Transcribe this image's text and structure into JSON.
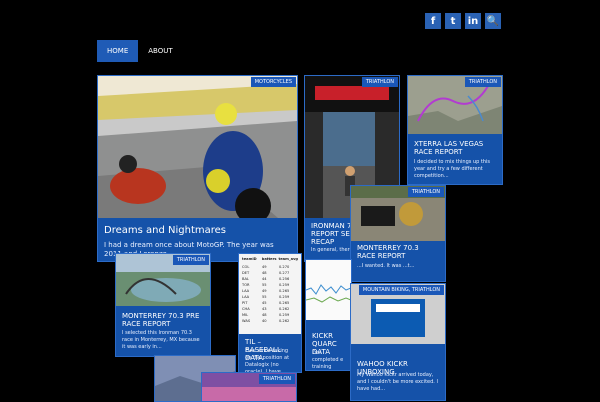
{
  "social": [
    "f",
    "t",
    "in",
    "🔍"
  ],
  "nav": [
    "HOME",
    "ABOUT"
  ],
  "cards": {
    "motogp": {
      "category": "MOTORCYCLES",
      "title": "Dreams and Nightmares",
      "excerpt": "I had a dream once about MotoGP. The year was 2011 and Lorenzo..."
    },
    "ironman": {
      "category": "TRIATHLON",
      "title": "IRONMAN 70.3 RACE REPORT SEASON RECAP",
      "excerpt": "In general, there you a..."
    },
    "xterra": {
      "category": "TRIATHLON",
      "title": "XTERRA LAS VEGAS RACE REPORT",
      "excerpt": "I decided to mix things up this year and try a few different competition..."
    },
    "monterrey": {
      "category": "TRIATHLON",
      "title": "MONTERREY 70.3 RACE REPORT",
      "excerpt": "...I wanted. It was ...t..."
    },
    "pre": {
      "category": "TRIATHLON",
      "title": "MONTERREY 70.3 PRE RACE REPORT",
      "excerpt": "I selected this Ironman 70.3 race in Monterrey, MX because it was early in..."
    },
    "baseball": {
      "title": "TIL – BASEBALL DATA",
      "excerpt": "Ever since taking on the position at Datalogix (no oracle), I have been..."
    },
    "kickr": {
      "title": "KICKR QUARC DATA",
      "excerpt": "I've completed e training session ... Kickr. During my..."
    },
    "wahoo": {
      "category": "MOUNTAIN BIKING, TRIATHLON",
      "title": "WAHOO KICKR UNBOXING",
      "excerpt": "My Wahoo Kickr arrived today, and I couldn't be more excited. I have had..."
    },
    "bottom": {
      "category": "TRIATHLON"
    }
  },
  "table": {
    "headers": [
      "teamID",
      "batters",
      "team_avg"
    ],
    "rows": [
      [
        "COL",
        "49",
        "0.270"
      ],
      [
        "DET",
        "48",
        "0.277"
      ],
      [
        "BAL",
        "44",
        "0.256"
      ],
      [
        "TOR",
        "55",
        "0.259"
      ],
      [
        "LAA",
        "49",
        "0.265"
      ],
      [
        "LAA",
        "55",
        "0.259"
      ],
      [
        "PIT",
        "45",
        "0.265"
      ],
      [
        "CHA",
        "43",
        "0.262"
      ],
      [
        "MIL",
        "48",
        "0.259"
      ],
      [
        "WAS",
        "40",
        "0.262"
      ]
    ]
  },
  "colors": {
    "accent": "#1f5bb6",
    "card": "#1552a9",
    "background": "#000000"
  }
}
